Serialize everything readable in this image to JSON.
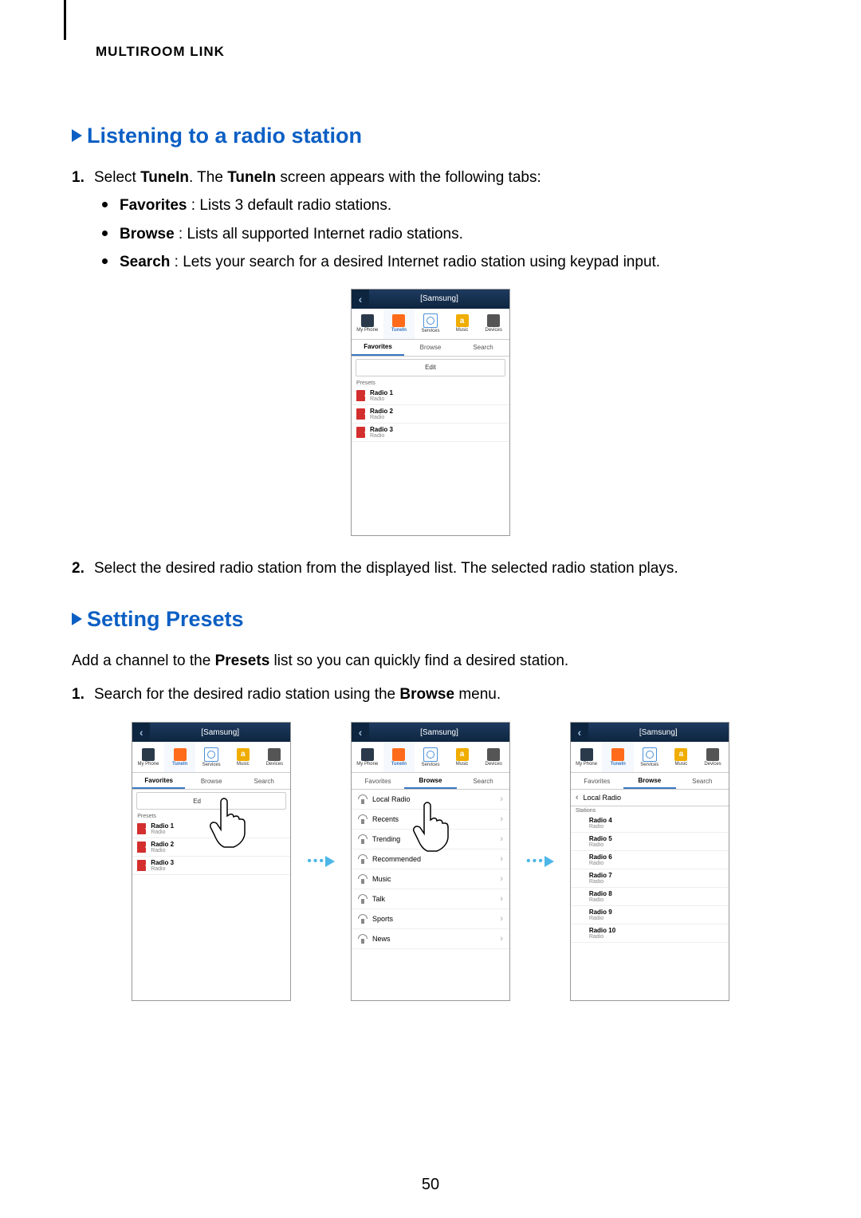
{
  "header_section": "MULTIROOM LINK",
  "h1": "Listening to a radio station",
  "step1_lead": "Select ",
  "step1_b1": "TuneIn",
  "step1_mid": ". The ",
  "step1_b2": "TuneIn",
  "step1_tail": " screen appears with the following tabs:",
  "bullet_fav_b": "Favorites",
  "bullet_fav_t": " : Lists 3 default radio stations.",
  "bullet_browse_b": "Browse",
  "bullet_browse_t": " : Lists all supported Internet radio stations.",
  "bullet_search_b": "Search",
  "bullet_search_t": " : Lets your search for a desired Internet radio station using keypad input.",
  "step2": "Select the desired radio station from the displayed list. The selected radio station plays.",
  "h2": "Setting Presets",
  "presets_intro_a": "Add a channel to the ",
  "presets_intro_b": "Presets",
  "presets_intro_c": " list so you can quickly find a desired station.",
  "presets_step1_a": "Search for the desired radio station using the ",
  "presets_step1_b": "Browse",
  "presets_step1_c": " menu.",
  "page_number": "50",
  "shot": {
    "title": "[Samsung]",
    "nav": {
      "phone": "My Phone",
      "tunein": "TuneIn",
      "services": "Services",
      "music": "Music",
      "devices": "Devices"
    },
    "tabs": {
      "fav": "Favorites",
      "browse": "Browse",
      "search": "Search"
    },
    "edit": "Edit",
    "edit_partial": "Ed",
    "presets_label": "Presets",
    "stations_label": "Stations",
    "local_radio": "Local Radio",
    "r1": {
      "t": "Radio 1",
      "s": "Radio"
    },
    "r2": {
      "t": "Radio 2",
      "s": "Radio"
    },
    "r3": {
      "t": "Radio 3",
      "s": "Radio"
    },
    "r4": {
      "t": "Radio 4",
      "s": "Radio"
    },
    "r5": {
      "t": "Radio 5",
      "s": "Radio"
    },
    "r6": {
      "t": "Radio 6",
      "s": "Radio"
    },
    "r7": {
      "t": "Radio 7",
      "s": "Radio"
    },
    "r8": {
      "t": "Radio 8",
      "s": "Radio"
    },
    "r9": {
      "t": "Radio 9",
      "s": "Radio"
    },
    "r10": {
      "t": "Radio 10",
      "s": "Radio"
    },
    "browse_items": {
      "b1": "Local Radio",
      "b2": "Recents",
      "b3": "Trending",
      "b4": "Recommended",
      "b5": "Music",
      "b6": "Talk",
      "b7": "Sports",
      "b8": "News"
    }
  }
}
